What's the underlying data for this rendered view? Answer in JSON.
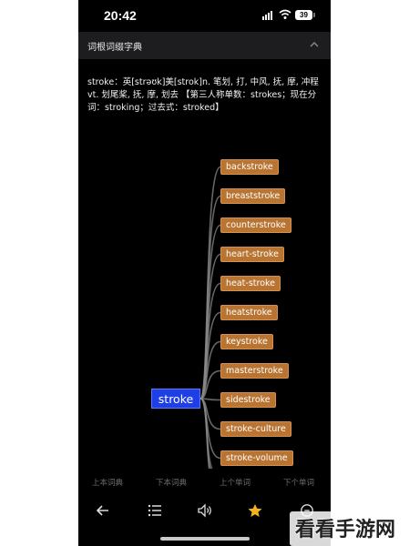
{
  "status_bar": {
    "time": "20:42",
    "battery": "39"
  },
  "header": {
    "title": "词根词缀字典"
  },
  "definition": "stroke：英[strəʊk]美[strok]n. 笔划, 打, 中风, 抚, 摩, 冲程 vt. 划尾桨, 抚, 摩, 划去 【第三人称单数：strokes；现在分词：stroking；过去式：stroked】",
  "mindmap": {
    "root": "stroke",
    "root_color": "#1f3fe6",
    "node_color": "#b97431",
    "children": [
      "backstroke",
      "breaststroke",
      "counterstroke",
      "heart-stroke",
      "heat-stroke",
      "heatstroke",
      "keystroke",
      "masterstroke",
      "sidestroke",
      "stroke-culture",
      "stroke-volume"
    ]
  },
  "bottom_tabs": [
    "上本词典",
    "下本词典",
    "上个单词",
    "下个单词"
  ],
  "toolbar_icons": [
    "back-arrow-icon",
    "list-icon",
    "speaker-icon",
    "star-icon",
    "circle-icon"
  ],
  "watermark": "看看手游网"
}
